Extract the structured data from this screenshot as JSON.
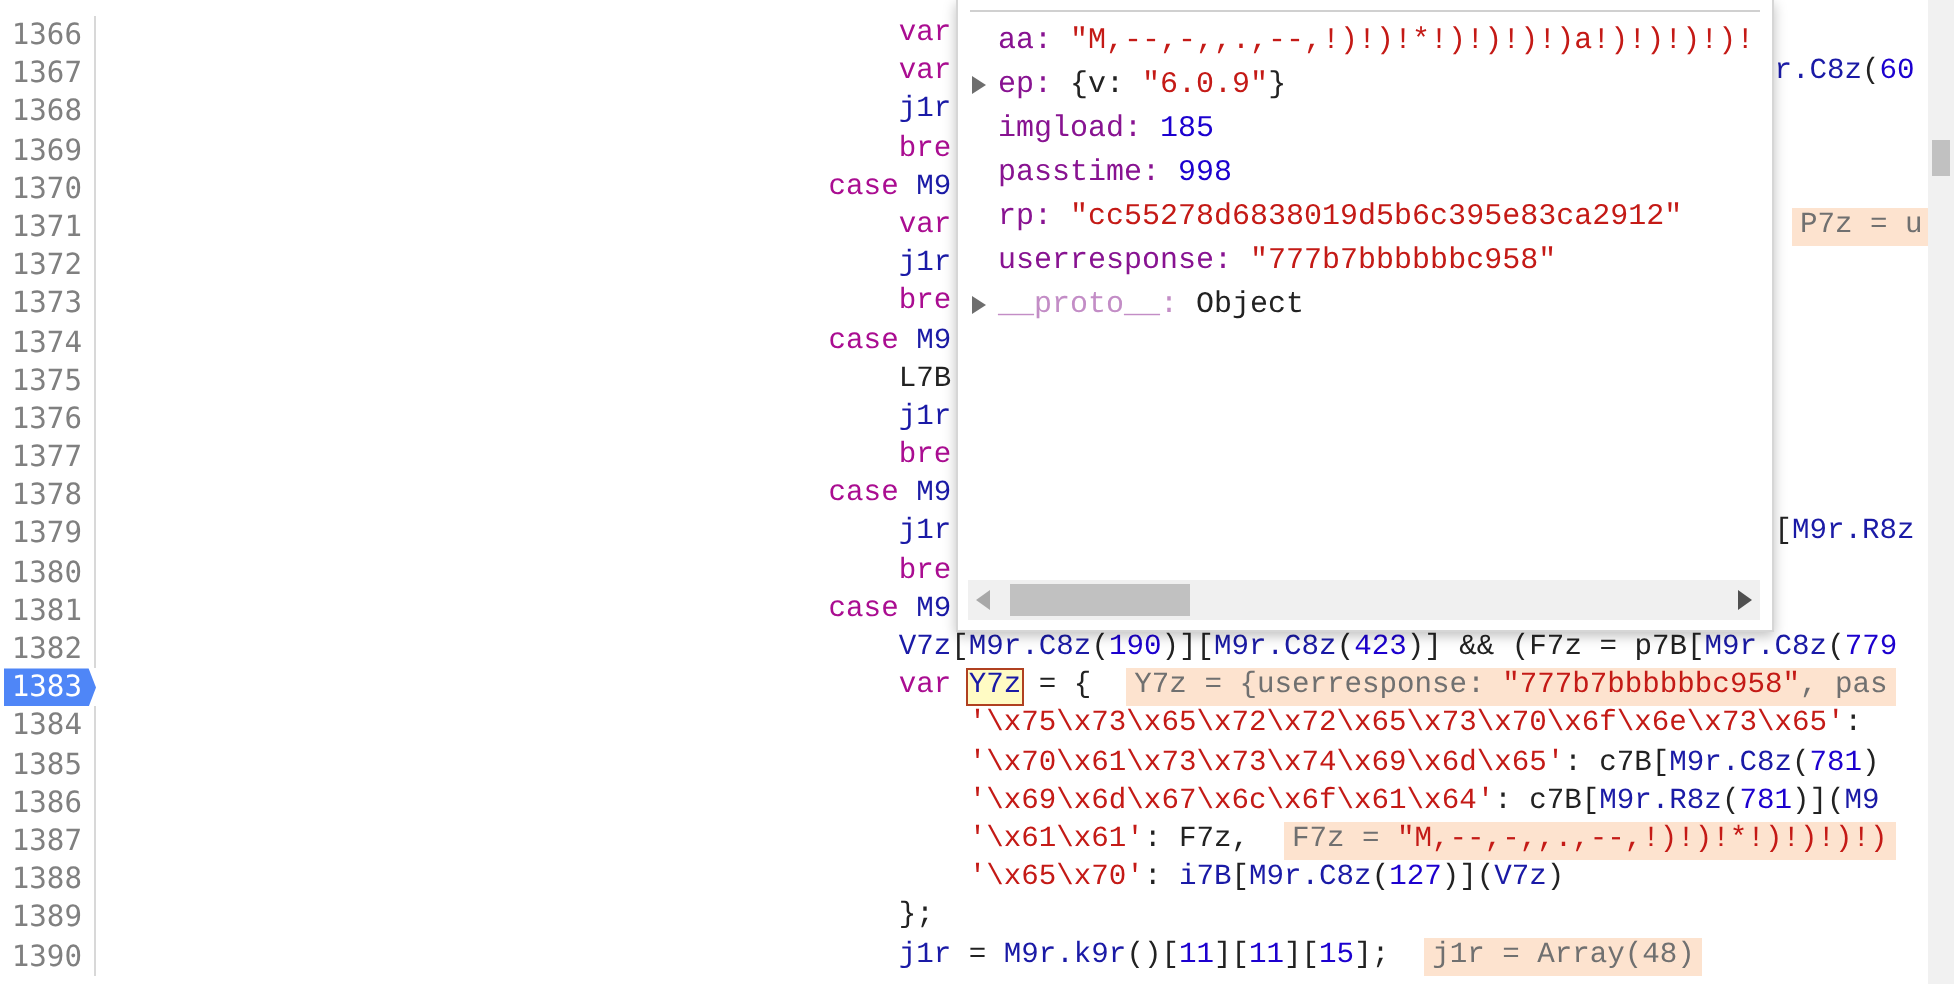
{
  "lines": [
    {
      "number": "1366",
      "breakpoint": false,
      "left": [
        {
          "kind": "code",
          "tokens": [
            {
              "kind": "kw",
              "text": "var"
            }
          ]
        }
      ]
    },
    {
      "number": "1367",
      "breakpoint": false,
      "left": [
        {
          "kind": "code",
          "tokens": [
            {
              "kind": "kw",
              "text": "var"
            }
          ]
        }
      ],
      "right": [
        {
          "kind": "code",
          "tokens": [
            {
              "kind": "var",
              "text": "r.C8z"
            },
            {
              "kind": "plain",
              "text": "("
            },
            {
              "kind": "num",
              "text": "60"
            }
          ]
        }
      ]
    },
    {
      "number": "1368",
      "breakpoint": false,
      "left": [
        {
          "kind": "code",
          "tokens": [
            {
              "kind": "var",
              "text": "j1r"
            }
          ]
        }
      ]
    },
    {
      "number": "1369",
      "breakpoint": false,
      "left": [
        {
          "kind": "code",
          "tokens": [
            {
              "kind": "kw",
              "text": "bre"
            }
          ]
        }
      ]
    },
    {
      "number": "1370",
      "breakpoint": false,
      "left": [
        {
          "kind": "code",
          "tokens": [
            {
              "kind": "kw",
              "text": "case "
            },
            {
              "kind": "var",
              "text": "M9"
            }
          ]
        }
      ]
    },
    {
      "number": "1371",
      "breakpoint": false,
      "left": [
        {
          "kind": "code",
          "tokens": [
            {
              "kind": "kw",
              "text": "var"
            }
          ]
        }
      ],
      "right": [
        {
          "kind": "value",
          "tokens": [
            {
              "kind": "name",
              "text": "P7z = u"
            }
          ]
        }
      ]
    },
    {
      "number": "1372",
      "breakpoint": false,
      "left": [
        {
          "kind": "code",
          "tokens": [
            {
              "kind": "var",
              "text": "j1r"
            }
          ]
        }
      ]
    },
    {
      "number": "1373",
      "breakpoint": false,
      "left": [
        {
          "kind": "code",
          "tokens": [
            {
              "kind": "kw",
              "text": "bre"
            }
          ]
        }
      ]
    },
    {
      "number": "1374",
      "breakpoint": false,
      "left": [
        {
          "kind": "code",
          "tokens": [
            {
              "kind": "kw",
              "text": "case "
            },
            {
              "kind": "var",
              "text": "M9"
            }
          ]
        }
      ]
    },
    {
      "number": "1375",
      "breakpoint": false,
      "left": [
        {
          "kind": "code",
          "tokens": [
            {
              "kind": "plain",
              "text": "L7B"
            }
          ]
        }
      ]
    },
    {
      "number": "1376",
      "breakpoint": false,
      "left": [
        {
          "kind": "code",
          "tokens": [
            {
              "kind": "var",
              "text": "j1r"
            }
          ]
        }
      ]
    },
    {
      "number": "1377",
      "breakpoint": false,
      "left": [
        {
          "kind": "code",
          "tokens": [
            {
              "kind": "kw",
              "text": "bre"
            }
          ]
        }
      ]
    },
    {
      "number": "1378",
      "breakpoint": false,
      "left": [
        {
          "kind": "code",
          "tokens": [
            {
              "kind": "kw",
              "text": "case "
            },
            {
              "kind": "var",
              "text": "M9"
            }
          ]
        }
      ]
    },
    {
      "number": "1379",
      "breakpoint": false,
      "left": [
        {
          "kind": "code",
          "tokens": [
            {
              "kind": "var",
              "text": "j1r"
            }
          ]
        }
      ],
      "right": [
        {
          "kind": "code",
          "tokens": [
            {
              "kind": "plain",
              "text": "["
            },
            {
              "kind": "var",
              "text": "M9r.R8z"
            }
          ]
        }
      ]
    },
    {
      "number": "1380",
      "breakpoint": false,
      "left": [
        {
          "kind": "code",
          "tokens": [
            {
              "kind": "kw",
              "text": "bre"
            }
          ]
        }
      ]
    },
    {
      "number": "1381",
      "breakpoint": false,
      "left": [
        {
          "kind": "code",
          "tokens": [
            {
              "kind": "kw",
              "text": "case "
            },
            {
              "kind": "var",
              "text": "M9"
            }
          ]
        }
      ]
    },
    {
      "number": "1382",
      "breakpoint": false,
      "left": [
        {
          "kind": "code",
          "tokens": [
            {
              "kind": "var",
              "text": "V7z"
            },
            {
              "kind": "plain",
              "text": "["
            },
            {
              "kind": "var",
              "text": "M9r.C8z"
            },
            {
              "kind": "plain",
              "text": "("
            },
            {
              "kind": "num",
              "text": "190"
            },
            {
              "kind": "plain",
              "text": ")]["
            },
            {
              "kind": "var",
              "text": "M9r.C8z"
            },
            {
              "kind": "plain",
              "text": "("
            },
            {
              "kind": "num",
              "text": "423"
            },
            {
              "kind": "plain",
              "text": ")] && (F7z = p7B["
            },
            {
              "kind": "var",
              "text": "M9r.C8z"
            },
            {
              "kind": "plain",
              "text": "("
            },
            {
              "kind": "num",
              "text": "779"
            }
          ]
        }
      ]
    },
    {
      "number": "1383",
      "breakpoint": true,
      "left": [
        {
          "kind": "code",
          "tokens": [
            {
              "kind": "kw",
              "text": "var"
            }
          ]
        },
        {
          "kind": "highlight",
          "text": "Y7z"
        },
        {
          "kind": "code",
          "tokens": [
            {
              "kind": "plain",
              "text": "= {"
            }
          ]
        },
        {
          "kind": "value",
          "tokens": [
            {
              "kind": "name",
              "text": "Y7z = {userresponse: "
            },
            {
              "kind": "str",
              "text": "\"777b7bbbbbbc958\""
            },
            {
              "kind": "name",
              "text": ", pas"
            }
          ]
        }
      ]
    },
    {
      "number": "1384",
      "breakpoint": false,
      "left": [
        {
          "kind": "code",
          "tokens": [
            {
              "kind": "str",
              "text": "'\\x75\\x73\\x65\\x72\\x72\\x65\\x73\\x70\\x6f\\x6e\\x73\\x65'"
            },
            {
              "kind": "plain",
              "text": ":"
            }
          ]
        }
      ]
    },
    {
      "number": "1385",
      "breakpoint": false,
      "left": [
        {
          "kind": "code",
          "tokens": [
            {
              "kind": "str",
              "text": "'\\x70\\x61\\x73\\x73\\x74\\x69\\x6d\\x65'"
            },
            {
              "kind": "plain",
              "text": ": c7B["
            },
            {
              "kind": "var",
              "text": "M9r.C8z"
            },
            {
              "kind": "plain",
              "text": "("
            },
            {
              "kind": "num",
              "text": "781"
            },
            {
              "kind": "plain",
              "text": ")"
            }
          ]
        }
      ]
    },
    {
      "number": "1386",
      "breakpoint": false,
      "left": [
        {
          "kind": "code",
          "tokens": [
            {
              "kind": "str",
              "text": "'\\x69\\x6d\\x67\\x6c\\x6f\\x61\\x64'"
            },
            {
              "kind": "plain",
              "text": ": c7B["
            },
            {
              "kind": "var",
              "text": "M9r.R8z"
            },
            {
              "kind": "plain",
              "text": "("
            },
            {
              "kind": "num",
              "text": "781"
            },
            {
              "kind": "plain",
              "text": ")]("
            },
            {
              "kind": "var",
              "text": "M9"
            }
          ]
        }
      ]
    },
    {
      "number": "1387",
      "breakpoint": false,
      "left": [
        {
          "kind": "code",
          "tokens": [
            {
              "kind": "str",
              "text": "'\\x61\\x61'"
            },
            {
              "kind": "plain",
              "text": ": F7z,"
            }
          ]
        },
        {
          "kind": "value",
          "tokens": [
            {
              "kind": "name",
              "text": "F7z = "
            },
            {
              "kind": "str",
              "text": "\"M,--,-,,.,--,!)!)!*!)!)!)!)"
            }
          ]
        }
      ]
    },
    {
      "number": "1388",
      "breakpoint": false,
      "left": [
        {
          "kind": "code",
          "tokens": [
            {
              "kind": "str",
              "text": "'\\x65\\x70'"
            },
            {
              "kind": "plain",
              "text": ": "
            },
            {
              "kind": "var",
              "text": "i7B"
            },
            {
              "kind": "plain",
              "text": "["
            },
            {
              "kind": "var",
              "text": "M9r.C8z"
            },
            {
              "kind": "plain",
              "text": "("
            },
            {
              "kind": "num",
              "text": "127"
            },
            {
              "kind": "plain",
              "text": ")]("
            },
            {
              "kind": "var",
              "text": "V7z"
            },
            {
              "kind": "plain",
              "text": ")"
            }
          ]
        }
      ]
    },
    {
      "number": "1389",
      "breakpoint": false,
      "left": [
        {
          "kind": "code",
          "tokens": [
            {
              "kind": "plain",
              "text": "};"
            }
          ]
        }
      ]
    },
    {
      "number": "1390",
      "breakpoint": false,
      "left": [
        {
          "kind": "code",
          "tokens": [
            {
              "kind": "var",
              "text": "j1r"
            },
            {
              "kind": "plain",
              "text": " = "
            },
            {
              "kind": "var",
              "text": "M9r.k9r"
            },
            {
              "kind": "plain",
              "text": "()["
            },
            {
              "kind": "num",
              "text": "11"
            },
            {
              "kind": "plain",
              "text": "]["
            },
            {
              "kind": "num",
              "text": "11"
            },
            {
              "kind": "plain",
              "text": "]["
            },
            {
              "kind": "num",
              "text": "15"
            },
            {
              "kind": "plain",
              "text": "];"
            }
          ]
        },
        {
          "kind": "value",
          "tokens": [
            {
              "kind": "name",
              "text": "j1r = Array(48)"
            }
          ]
        }
      ]
    }
  ],
  "popover": {
    "properties": [
      {
        "label": "aa:",
        "value": [
          {
            "kind": "str",
            "text": "\"M,--,-,,.,--,!)!)!*!)!)!)!)a!)!)!)!)!"
          }
        ]
      },
      {
        "label": "ep:",
        "expanded": false,
        "value": [
          {
            "kind": "plain",
            "text": "{v: "
          },
          {
            "kind": "str",
            "text": "\"6.0.9\""
          },
          {
            "kind": "plain",
            "text": "}"
          }
        ]
      },
      {
        "label": "imgload:",
        "value": [
          {
            "kind": "num",
            "text": "185"
          }
        ]
      },
      {
        "label": "passtime:",
        "value": [
          {
            "kind": "num",
            "text": "998"
          }
        ]
      },
      {
        "label": "rp:",
        "value": [
          {
            "kind": "str",
            "text": "\"cc55278d6838019d5b6c395e83ca2912\""
          }
        ]
      },
      {
        "label": "userresponse:",
        "value": [
          {
            "kind": "str",
            "text": "\"777b7bbbbbbc958\""
          }
        ]
      },
      {
        "label": "__proto__:",
        "internal": true,
        "expanded": false,
        "value": [
          {
            "kind": "plain",
            "text": "Object"
          }
        ]
      }
    ]
  }
}
